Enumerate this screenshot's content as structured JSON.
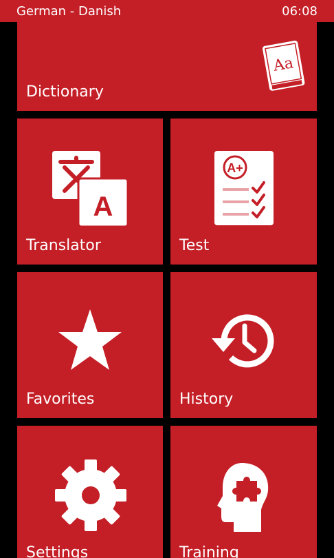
{
  "status_bar": {
    "title": "German - Danish",
    "time": "06:08"
  },
  "tiles": [
    {
      "label": "Dictionary",
      "icon": "dictionary-book-icon"
    },
    {
      "label": "Translator",
      "icon": "translator-icon"
    },
    {
      "label": "Test",
      "icon": "test-clipboard-icon"
    },
    {
      "label": "Favorites",
      "icon": "star-icon"
    },
    {
      "label": "History",
      "icon": "history-clock-icon"
    },
    {
      "label": "Settings",
      "icon": "gear-icon"
    },
    {
      "label": "Training",
      "icon": "brain-puzzle-icon"
    }
  ],
  "icon_text": {
    "book": "Aa",
    "translator_a": "A",
    "grade": "A+"
  },
  "colors": {
    "accent": "#c41e26",
    "background": "#000000",
    "foreground": "#ffffff"
  }
}
